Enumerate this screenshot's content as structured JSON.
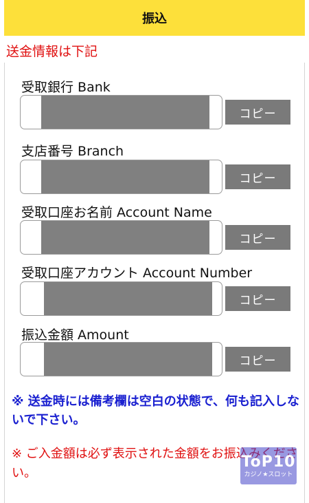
{
  "header": {
    "title": "振込"
  },
  "notice_top": "送金情報は下記",
  "fields": [
    {
      "label": "受取銀行 Bank",
      "copy_label": "コピー"
    },
    {
      "label": "支店番号 Branch",
      "copy_label": "コピー"
    },
    {
      "label": "受取口座お名前 Account Name",
      "copy_label": "コピー"
    },
    {
      "label": "受取口座アカウント Account Number",
      "copy_label": "コピー"
    },
    {
      "label": "振込金額 Amount",
      "copy_label": "コピー"
    }
  ],
  "notice_blue": "※ 送金時には備考欄は空白の状態で、何も記入しないで下さい。",
  "notice_red": "※ ご入金額は必ず表示された金額をお振込みください。",
  "logo": {
    "main": "ToP10",
    "sub": "カジノ★スロット"
  },
  "colors": {
    "header_bg": "#fde03a",
    "red_text": "#e01010",
    "blue_text": "#1a20d0",
    "button_bg": "#7a7a7a"
  }
}
